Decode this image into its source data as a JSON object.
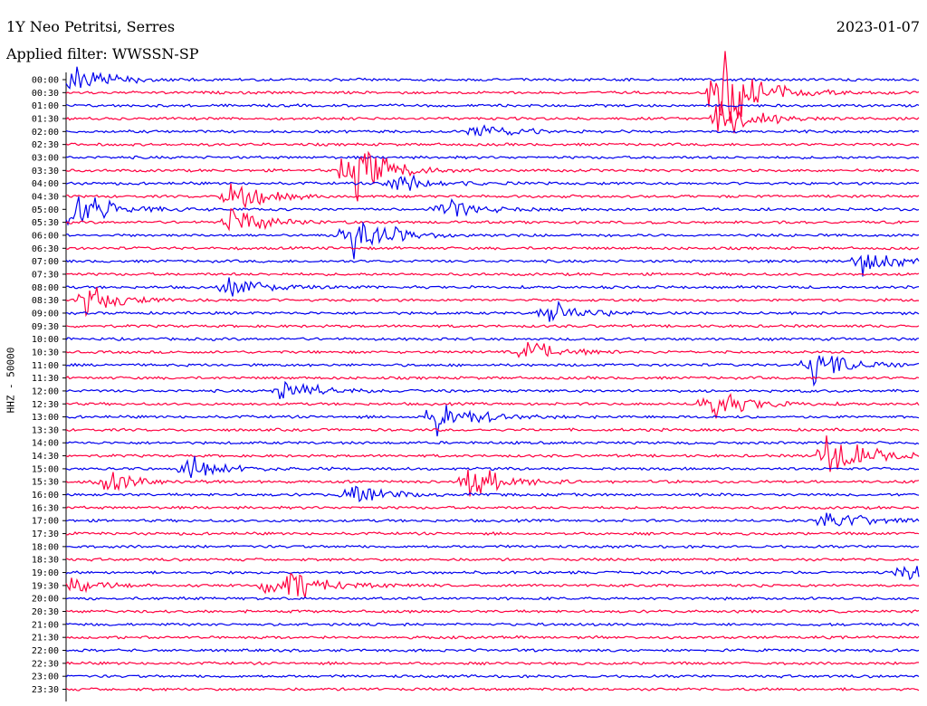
{
  "header": {
    "station": "1Y Neo Petritsi, Serres",
    "filter": "Applied filter: WWSSN-SP",
    "date": "2023-01-07"
  },
  "chart_data": {
    "type": "line",
    "title": "1Y Neo Petritsi, Serres",
    "ylabel": "HHZ - 50000",
    "time_labels": [
      "00:00",
      "00:30",
      "01:00",
      "01:30",
      "02:00",
      "02:30",
      "03:00",
      "03:30",
      "04:00",
      "04:30",
      "05:00",
      "05:30",
      "06:00",
      "06:30",
      "07:00",
      "07:30",
      "08:00",
      "08:30",
      "09:00",
      "09:30",
      "10:00",
      "10:30",
      "11:00",
      "11:30",
      "12:00",
      "12:30",
      "13:00",
      "13:30",
      "14:00",
      "14:30",
      "15:00",
      "15:30",
      "16:00",
      "16:30",
      "17:00",
      "17:30",
      "18:00",
      "18:30",
      "19:00",
      "19:30",
      "20:00",
      "20:30",
      "21:00",
      "21:30",
      "22:00",
      "22:30",
      "23:00",
      "23:30"
    ],
    "colors": {
      "even": "#0000ee",
      "odd": "#ff0040"
    },
    "events": [
      {
        "time": "00:00",
        "x": 0.0,
        "amp": 1.0
      },
      {
        "time": "00:30",
        "x": 0.76,
        "amp": 2.8
      },
      {
        "time": "01:30",
        "x": 0.76,
        "amp": 1.2
      },
      {
        "time": "02:00",
        "x": 0.48,
        "amp": 0.6
      },
      {
        "time": "03:30",
        "x": 0.33,
        "amp": 1.8
      },
      {
        "time": "04:00",
        "x": 0.38,
        "amp": 0.6
      },
      {
        "time": "04:30",
        "x": 0.19,
        "amp": 0.9
      },
      {
        "time": "05:00",
        "x": 0.0,
        "amp": 1.4
      },
      {
        "time": "05:00",
        "x": 0.43,
        "amp": 0.7
      },
      {
        "time": "05:30",
        "x": 0.19,
        "amp": 0.8
      },
      {
        "time": "06:00",
        "x": 0.33,
        "amp": 1.5
      },
      {
        "time": "07:00",
        "x": 0.93,
        "amp": 0.7
      },
      {
        "time": "08:00",
        "x": 0.19,
        "amp": 0.7
      },
      {
        "time": "08:30",
        "x": 0.02,
        "amp": 0.8
      },
      {
        "time": "09:00",
        "x": 0.56,
        "amp": 0.7
      },
      {
        "time": "10:30",
        "x": 0.54,
        "amp": 0.6
      },
      {
        "time": "11:00",
        "x": 0.87,
        "amp": 1.0
      },
      {
        "time": "12:00",
        "x": 0.25,
        "amp": 0.8
      },
      {
        "time": "12:30",
        "x": 0.75,
        "amp": 1.0
      },
      {
        "time": "13:00",
        "x": 0.43,
        "amp": 1.2
      },
      {
        "time": "14:30",
        "x": 0.89,
        "amp": 1.4
      },
      {
        "time": "15:00",
        "x": 0.14,
        "amp": 0.7
      },
      {
        "time": "15:30",
        "x": 0.04,
        "amp": 0.8
      },
      {
        "time": "15:30",
        "x": 0.47,
        "amp": 1.2
      },
      {
        "time": "16:00",
        "x": 0.33,
        "amp": 0.6
      },
      {
        "time": "17:00",
        "x": 0.89,
        "amp": 0.7
      },
      {
        "time": "19:00",
        "x": 0.98,
        "amp": 0.5
      },
      {
        "time": "19:30",
        "x": 0.0,
        "amp": 0.4
      },
      {
        "time": "19:30",
        "x": 0.23,
        "amp": 0.7
      },
      {
        "time": "19:30",
        "x": 0.26,
        "amp": 0.6
      }
    ]
  }
}
